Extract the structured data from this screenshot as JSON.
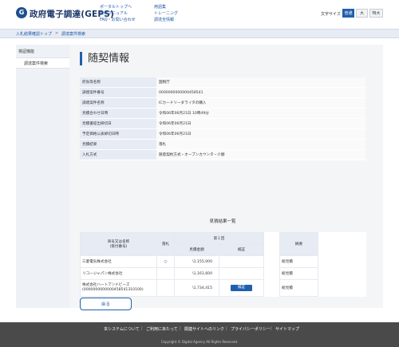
{
  "header": {
    "logo_glyph": "G",
    "site_title": "政府電子調達(GEPS)",
    "links_col1": [
      "ポータルトップへ",
      "操作マニュアル",
      "FAQ・お問い合わせ"
    ],
    "links_col2": [
      "用語集",
      "トレーニング",
      "調達全情報"
    ],
    "font_size_label": "文字サイズ",
    "font_sizes": [
      "普通",
      "大",
      "特大"
    ],
    "active_font_size": "普通"
  },
  "breadcrumb": [
    "入札結果確認トップ",
    "調達案件検索"
  ],
  "breadcrumb_separator": ">",
  "sidebar": {
    "heading": "検証機能",
    "items": [
      "調達案件検索"
    ]
  },
  "page_title": "随契情報",
  "info": [
    {
      "label": "府省等名称",
      "value": "国税庁"
    },
    {
      "label": "調達案件番号",
      "value": "0000000000000458541"
    },
    {
      "label": "調達案件名称",
      "value": "ICカードリーダライタの購入"
    },
    {
      "label": "見積合わせ日時",
      "value": "令和06年06月21日 10時49分"
    },
    {
      "label": "見積書提出締切日",
      "value": "令和06年06月21日"
    },
    {
      "label": "予定価格公表締切日時",
      "value": "令和06年06月21日"
    },
    {
      "label": "見積結果",
      "value": "落札"
    },
    {
      "label": "入札方式",
      "value": "随意契約方式・オープンカウンタ・少額"
    }
  ],
  "results_title": "見積結果一覧",
  "results": {
    "headers": {
      "company": "商号又は名称\n(受付番号)",
      "award": "落札",
      "round": "第１回",
      "amount": "見積金額",
      "check": "検証",
      "remarks": "摘要"
    },
    "rows": [
      {
        "company": "三菱電気株式会社",
        "company_sub": "",
        "award": "○",
        "amount": "\\1,155,000",
        "check": "",
        "remarks": "総見積"
      },
      {
        "company": "リコージャパン株式会社",
        "company_sub": "",
        "award": "",
        "amount": "\\1,161,600",
        "check": "",
        "remarks": "総見積"
      },
      {
        "company": "株式会社ハートアンドビーズ",
        "company_sub": "(0000000000000458541310100)",
        "award": "",
        "amount": "\\1,734,415",
        "check": "検証",
        "remarks": "総見積"
      }
    ]
  },
  "back_button": "戻る",
  "footer": {
    "links": [
      "本システムについて",
      "ご利用にあたって",
      "関連サイトへのリンク",
      "プライバシーポリシー",
      "サイトマップ"
    ],
    "copyright": "Copyright © Digital Agency All Rights Reserved."
  },
  "colors": {
    "accent": "#1f5fae",
    "label_bg": "#e6ebf4",
    "footer_bg": "#4a4a4a"
  }
}
